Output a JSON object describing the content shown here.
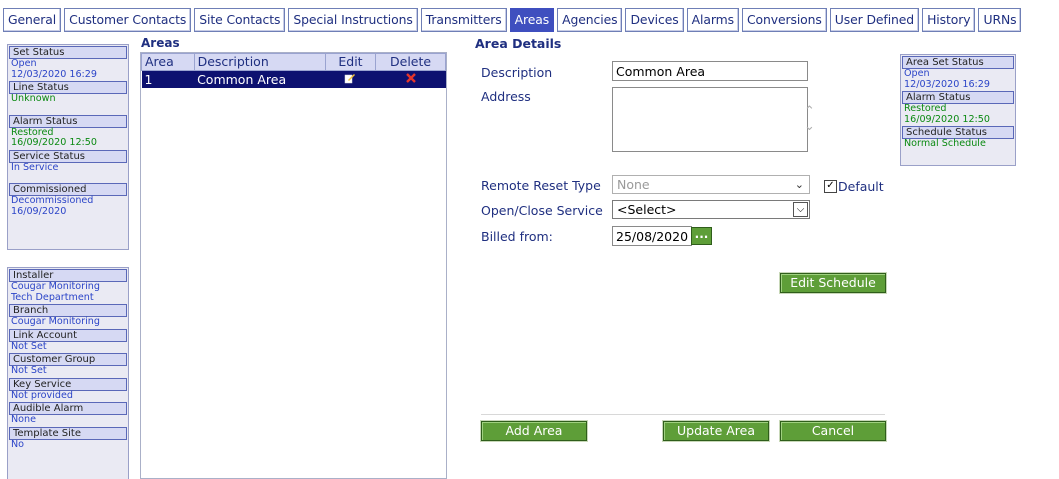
{
  "tabs": [
    {
      "label": "General"
    },
    {
      "label": "Customer Contacts"
    },
    {
      "label": "Site Contacts"
    },
    {
      "label": "Special Instructions"
    },
    {
      "label": "Transmitters"
    },
    {
      "label": "Areas"
    },
    {
      "label": "Agencies"
    },
    {
      "label": "Devices"
    },
    {
      "label": "Alarms"
    },
    {
      "label": "Conversions"
    },
    {
      "label": "User Defined"
    },
    {
      "label": "History"
    },
    {
      "label": "URNs"
    }
  ],
  "active_tab": "Areas",
  "status_panel": {
    "set_status": {
      "label": "Set Status",
      "value": "Open",
      "time": "12/03/2020 16:29"
    },
    "line_status": {
      "label": "Line Status",
      "value": "Unknown"
    },
    "alarm_status": {
      "label": "Alarm Status",
      "value": "Restored",
      "time": "16/09/2020 12:50"
    },
    "service_status": {
      "label": "Service Status",
      "value": "In Service"
    },
    "commissioned": {
      "label": "Commissioned",
      "value": "Decommissioned",
      "time": "16/09/2020"
    }
  },
  "site_panel": {
    "installer": {
      "label": "Installer",
      "value": "Cougar Monitoring",
      "value2": "Tech Department"
    },
    "branch": {
      "label": "Branch",
      "value": "Cougar Monitoring"
    },
    "link_account": {
      "label": "Link Account",
      "value": "Not Set"
    },
    "customer_group": {
      "label": "Customer Group",
      "value": "Not Set"
    },
    "key_service": {
      "label": "Key Service",
      "value": "Not provided"
    },
    "audible_alarm": {
      "label": "Audible Alarm",
      "value": "None"
    },
    "template_site": {
      "label": "Template Site",
      "value": "No"
    }
  },
  "areas": {
    "title": "Areas",
    "columns": [
      "Area",
      "Description",
      "Edit",
      "Delete"
    ],
    "rows": [
      {
        "area": "1",
        "description": "Common Area"
      }
    ]
  },
  "details": {
    "title": "Area Details",
    "description_label": "Description",
    "description_value": "Common Area",
    "address_label": "Address",
    "address_value": "",
    "remote_reset_label": "Remote Reset Type",
    "remote_reset_value": "None",
    "default_label": "Default",
    "default_checked": true,
    "open_close_label": "Open/Close Service",
    "open_close_value": "<Select>",
    "billed_from_label": "Billed from:",
    "billed_from_value": "25/08/2020",
    "date_picker_label": "...",
    "edit_schedule": "Edit Schedule",
    "add_area": "Add Area",
    "update_area": "Update Area",
    "cancel": "Cancel"
  },
  "area_status_panel": {
    "set": {
      "label": "Area Set Status",
      "value": "Open",
      "time": "12/03/2020 16:29"
    },
    "alarm": {
      "label": "Alarm Status",
      "value": "Restored",
      "time": "16/09/2020 12:50"
    },
    "schedule": {
      "label": "Schedule Status",
      "value": "Normal Schedule"
    }
  },
  "colors": {
    "accent": "#3f4fbf",
    "selected_row": "#0d1170",
    "button_green": "#5e9e38",
    "status_blue": "#2c45c8",
    "status_green": "#0b8a12"
  }
}
